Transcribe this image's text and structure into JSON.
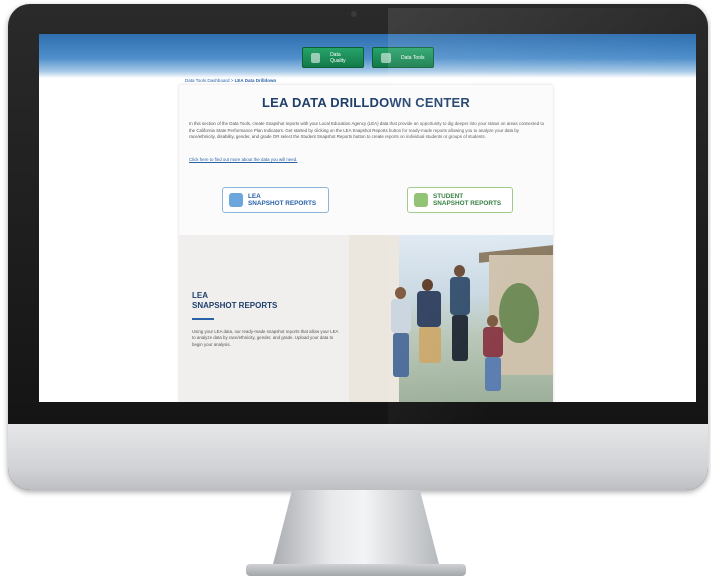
{
  "toolbar": {
    "btn1_label": "Data Quality",
    "btn2_label": "Data Tools"
  },
  "breadcrumb": {
    "parent": "Data Tools Dashboard",
    "separator": ">",
    "current": "LEA Data Drilldown"
  },
  "page": {
    "title": "LEA DATA DRILLDOWN CENTER",
    "description": "In this section of the Data Tools, create Snapshot reports with your Local Education Agency (LEA) data that provide an opportunity to dig deeper into your status on areas connected to the California State Performance Plan Indicators. Get started by clicking on the LEA Snapshot Reports button for ready-made reports allowing you to analyze your data by race/ethnicity, disability, gender, and grade OR select the Student Snapshot Reports button to create reports on individual students or groups of students.",
    "learn_link": "Click here to find out more about the data you will need."
  },
  "buttons": {
    "lea_line1": "LEA",
    "lea_line2": "SNAPSHOT REPORTS",
    "student_line1": "STUDENT",
    "student_line2": "SNAPSHOT REPORTS"
  },
  "feature": {
    "title_line1": "LEA",
    "title_line2": "SNAPSHOT REPORTS",
    "description": "Using your LEA data, our ready-made snapshot reports that allow your LEA to analyze data by race/ethnicity, gender, and grade. Upload your data to begin your analysis."
  },
  "colors": {
    "brand_blue": "#2f6fb0",
    "title_navy": "#1f3f6c",
    "button_green": "#137a49"
  }
}
